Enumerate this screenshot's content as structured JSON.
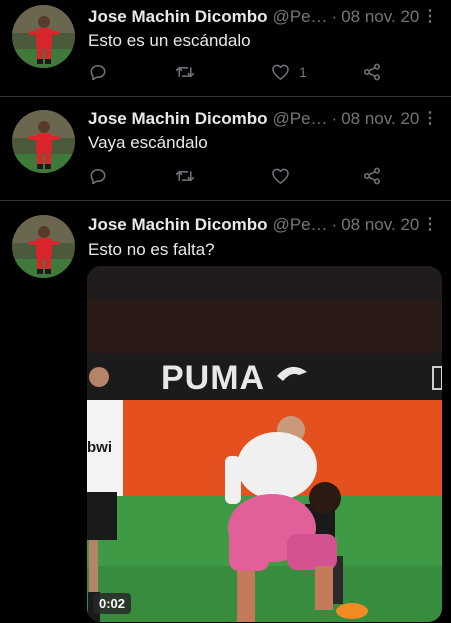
{
  "tweets": [
    {
      "name": "Jose Machin Dicombo",
      "handle": "@Pe…",
      "date": "08 nov. 20",
      "text": "Esto es un escándalo",
      "like_count": "1"
    },
    {
      "name": "Jose Machin Dicombo",
      "handle": "@Pe…",
      "date": "08 nov. 20",
      "text": "Vaya escándalo"
    },
    {
      "name": "Jose Machin Dicombo",
      "handle": "@Pe…",
      "date": "08 nov. 20",
      "text": "Esto no es falta?",
      "video": {
        "duration": "0:02",
        "banner_text": "PUMA"
      }
    }
  ],
  "ui": {
    "dot": "·",
    "more": "⋮"
  },
  "colors": {
    "background": "#000000",
    "text": "#e7e9ea",
    "muted": "#71767b",
    "divider": "#2f3336"
  }
}
